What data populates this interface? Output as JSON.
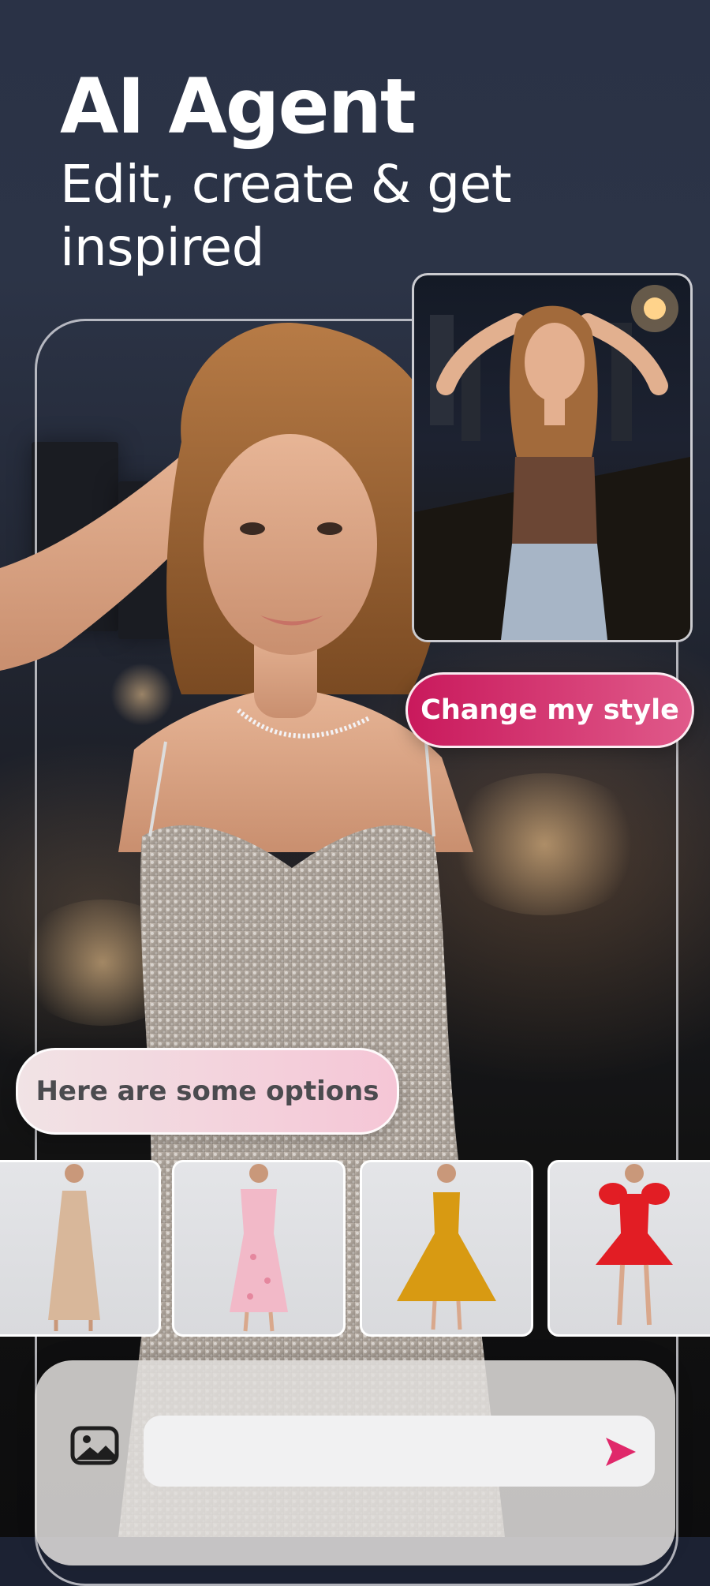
{
  "header": {
    "title": "AI Agent",
    "subtitle": "Edit, create & get inspired"
  },
  "chat": {
    "user_message": "Change my style",
    "ai_message": "Here are some options"
  },
  "options": [
    {
      "name": "champagne-satin-dress",
      "color": "#d8b79a"
    },
    {
      "name": "pink-floral-dress",
      "color": "#f2b9c8"
    },
    {
      "name": "yellow-satin-gown",
      "color": "#d89a12"
    },
    {
      "name": "red-puff-sleeve-dress",
      "color": "#e21d24"
    }
  ],
  "composer": {
    "placeholder": "",
    "image_icon": "image-icon",
    "send_icon": "send-icon"
  },
  "colors": {
    "accent": "#e0286a",
    "user_bubble": "#c9195c",
    "ai_bubble": "#f5c6d6"
  }
}
